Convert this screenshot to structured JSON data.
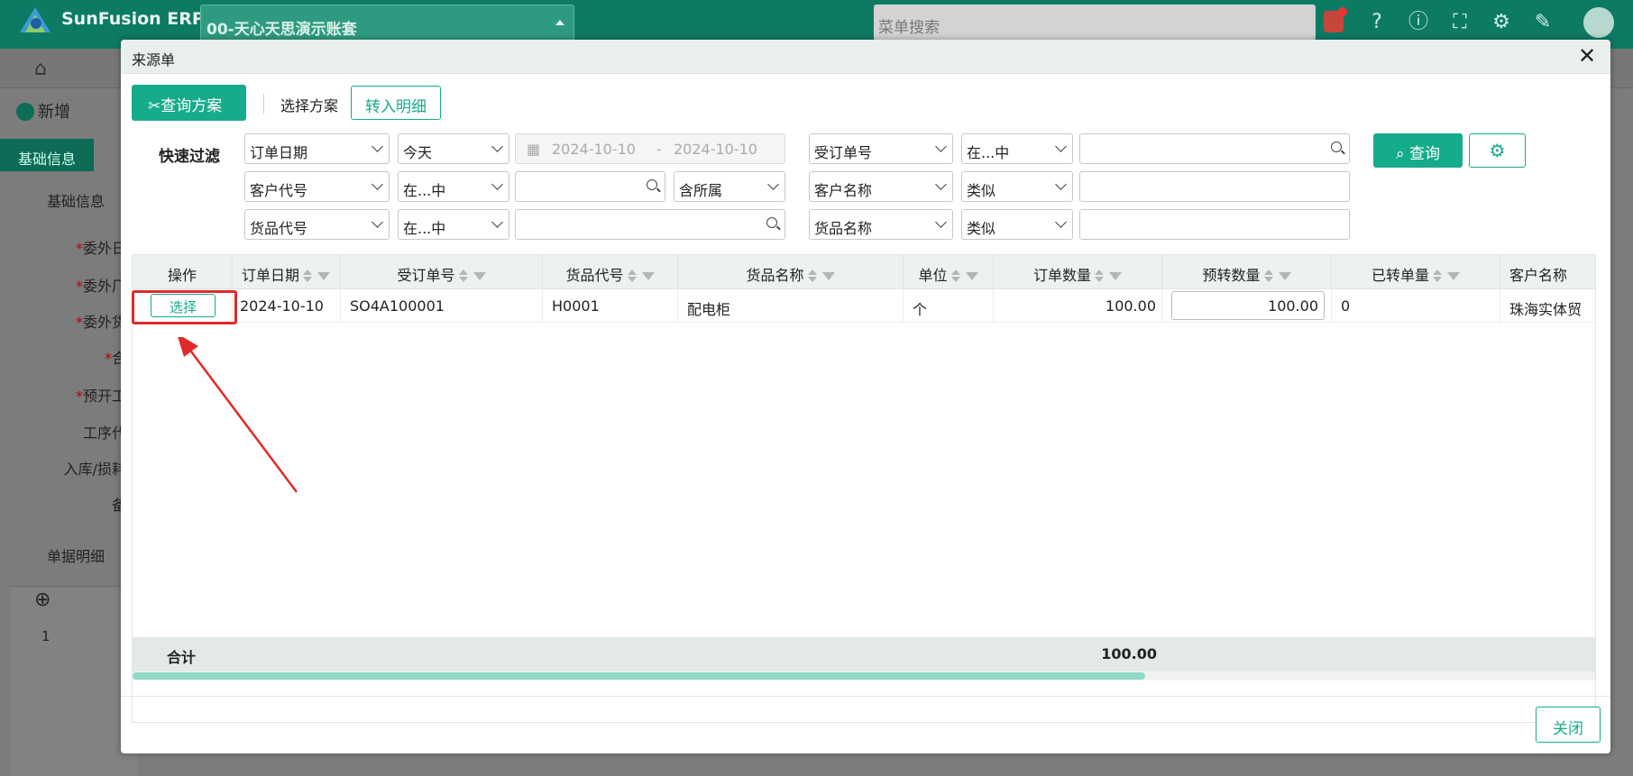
{
  "app": {
    "brand": "SunFusion ERP",
    "account": "00-天心天思演示账套",
    "menu_search_placeholder": "菜单搜索"
  },
  "background": {
    "new_label": "新增",
    "tab_basic": "基础信息",
    "section_basic": "基础信息",
    "fields": [
      "委外日",
      "委外厂",
      "委外货",
      "合",
      "预开工",
      "工序代",
      "入库/损耗",
      "备"
    ],
    "section_detail": "单据明细",
    "row_index": "1"
  },
  "modal": {
    "title": "来源单",
    "toolbar": {
      "query_scheme": "查询方案",
      "choose_scheme": "选择方案",
      "transfer_detail": "转入明细"
    },
    "quick_filter": {
      "label": "快速过滤",
      "row1": {
        "field": "订单日期",
        "op": "今天",
        "date_from": "2024-10-10",
        "date_sep": "-",
        "date_to": "2024-10-10",
        "field2": "受订单号",
        "op2": "在...中",
        "value2": ""
      },
      "row2": {
        "field": "客户代号",
        "op": "在...中",
        "value": "",
        "include": "含所属",
        "field2": "客户名称",
        "op2": "类似",
        "value2": ""
      },
      "row3": {
        "field": "货品代号",
        "op": "在...中",
        "value": "",
        "field2": "货品名称",
        "op2": "类似",
        "value2": ""
      },
      "query_button": "查询"
    },
    "table": {
      "headers": [
        "操作",
        "订单日期",
        "受订单号",
        "货品代号",
        "货品名称",
        "单位",
        "订单数量",
        "预转数量",
        "已转单量",
        "客户名称"
      ],
      "rows": [
        {
          "action": "选择",
          "order_date": "2024-10-10",
          "so_no": "SO4A100001",
          "item_code": "H0001",
          "item_name": "配电柜",
          "unit": "个",
          "order_qty": "100.00",
          "pre_qty": "100.00",
          "transferred": "0",
          "customer": "珠海实体贸"
        }
      ],
      "summary_label": "合计",
      "summary_order_qty": "100.00"
    },
    "footer": {
      "close": "关闭"
    }
  },
  "colors": {
    "brand_green": "#0d7a64",
    "accent": "#16ab8b",
    "highlight_red": "#e02a2a"
  }
}
